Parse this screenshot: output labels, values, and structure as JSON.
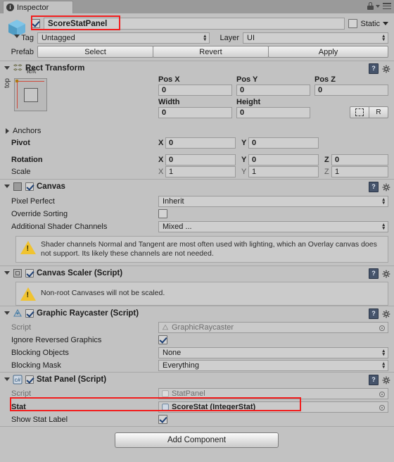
{
  "window": {
    "tab_label": "Inspector",
    "tab_icon": "info-icon",
    "lock_icon": "lock-icon",
    "menu_icon": "hamburger-menu-icon"
  },
  "gameobject": {
    "icon": "cube-icon",
    "enabled": true,
    "name": "ScoreStatPanel",
    "static_label": "Static",
    "static_checked": false,
    "tag_label": "Tag",
    "tag_value": "Untagged",
    "layer_label": "Layer",
    "layer_value": "UI",
    "prefab_label": "Prefab",
    "prefab_select": "Select",
    "prefab_revert": "Revert",
    "prefab_apply": "Apply"
  },
  "rect_transform": {
    "title": "Rect Transform",
    "anchor_preview": {
      "left_label": "left",
      "top_label": "top"
    },
    "anchors_label": "Anchors",
    "headers": {
      "pos_x": "Pos X",
      "pos_y": "Pos Y",
      "pos_z": "Pos Z",
      "width": "Width",
      "height": "Height"
    },
    "values": {
      "pos_x": "0",
      "pos_y": "0",
      "pos_z": "0",
      "width": "0",
      "height": "0"
    },
    "blueprint_button": "",
    "raw_button": "R",
    "pivot": {
      "label": "Pivot",
      "x_axis": "X",
      "x": "0",
      "y_axis": "Y",
      "y": "0"
    },
    "rotation": {
      "label": "Rotation",
      "x_axis": "X",
      "x": "0",
      "y_axis": "Y",
      "y": "0",
      "z_axis": "Z",
      "z": "0"
    },
    "scale": {
      "label": "Scale",
      "x_axis": "X",
      "x": "1",
      "y_axis": "Y",
      "y": "1",
      "z_axis": "Z",
      "z": "1"
    }
  },
  "canvas": {
    "title": "Canvas",
    "enabled": true,
    "pixel_perfect_label": "Pixel Perfect",
    "pixel_perfect_value": "Inherit",
    "override_sorting_label": "Override Sorting",
    "override_sorting_checked": false,
    "shader_channels_label": "Additional Shader Channels",
    "shader_channels_value": "Mixed ...",
    "warning": "Shader channels Normal and Tangent are most often used with lighting, which an Overlay canvas does not support. Its likely these channels are not needed."
  },
  "canvas_scaler": {
    "title": "Canvas Scaler (Script)",
    "enabled": true,
    "warning": "Non-root Canvases will not be scaled."
  },
  "graphic_raycaster": {
    "title": "Graphic Raycaster (Script)",
    "enabled": true,
    "script_label": "Script",
    "script_value": "GraphicRaycaster",
    "ignore_reversed_label": "Ignore Reversed Graphics",
    "ignore_reversed_checked": true,
    "blocking_objects_label": "Blocking Objects",
    "blocking_objects_value": "None",
    "blocking_mask_label": "Blocking Mask",
    "blocking_mask_value": "Everything"
  },
  "stat_panel": {
    "title": "Stat Panel (Script)",
    "enabled": true,
    "script_label": "Script",
    "script_value": "StatPanel",
    "stat_label": "Stat",
    "stat_value": "ScoreStat (IntegerStat)",
    "show_stat_label_label": "Show Stat Label",
    "show_stat_label_checked": true
  },
  "footer": {
    "add_component": "Add Component"
  },
  "colors": {
    "highlight": "#f21d1d",
    "panel_bg": "#c2c2c2",
    "field_bg": "#cfcfcf",
    "warning_yellow": "#f0c330"
  }
}
